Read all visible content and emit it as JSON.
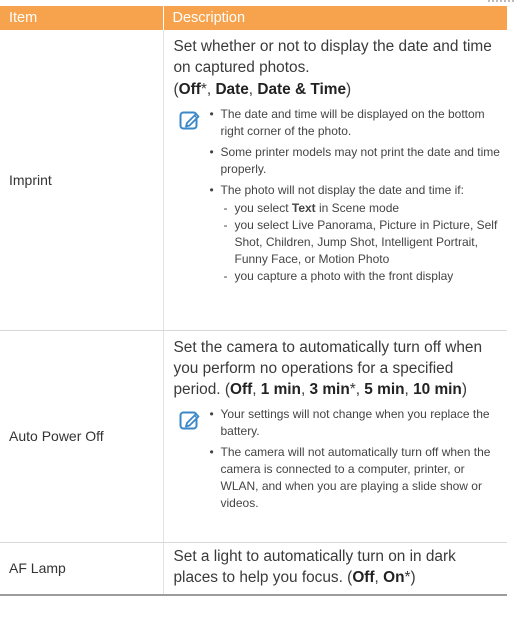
{
  "table": {
    "headers": [
      "Item",
      "Description"
    ],
    "rows": {
      "imprint": {
        "item": "Imprint",
        "desc_line": "Set whether or not to display the date and time on captured photos.",
        "opt_open": "(",
        "opt_off": "Off",
        "opt_off_mark": "*",
        "opt_sep1": ", ",
        "opt_date": "Date",
        "opt_sep2": ", ",
        "opt_datetime": "Date & Time",
        "opt_close": ")",
        "note_icon": "note-pencil-icon",
        "bullets": [
          "The date and time will be displayed on the bottom right corner of the photo.",
          "Some printer models may not print the date and time properly.",
          "The photo will not display the date and time if:"
        ],
        "sub": {
          "s1_a": "you select ",
          "s1_b": "Text",
          "s1_c": " in Scene mode",
          "s2": "you select Live Panorama, Picture in Picture, Self Shot, Children, Jump Shot, Intelligent Portrait, Funny Face, or Motion Photo",
          "s3": "you capture a photo with the front display"
        }
      },
      "apo": {
        "item": "Auto Power Off",
        "desc_a": "Set the camera to automatically turn off when you perform no operations for a specified period. (",
        "o1": "Off",
        "s1": ", ",
        "o2": "1 min",
        "s2": ", ",
        "o3": "3 min",
        "o3_mark": "*",
        "s3": ", ",
        "o4": "5 min",
        "s4": ", ",
        "o5": "10 min",
        "close": ")",
        "note_icon": "note-pencil-icon",
        "bullets": [
          "Your settings will not change when you replace the battery.",
          "The camera will not automatically turn off when the camera is connected to a computer, printer, or WLAN, and when you are playing a slide show or videos."
        ]
      },
      "af": {
        "item": "AF Lamp",
        "desc_a": "Set a light to automatically turn on in dark places to help you focus. (",
        "o1": "Off",
        "s1": ", ",
        "o2": "On",
        "o2_mark": "*",
        "close": ")"
      }
    }
  },
  "colors": {
    "header_bg": "#f7a24c",
    "icon": "#3b87c8"
  }
}
